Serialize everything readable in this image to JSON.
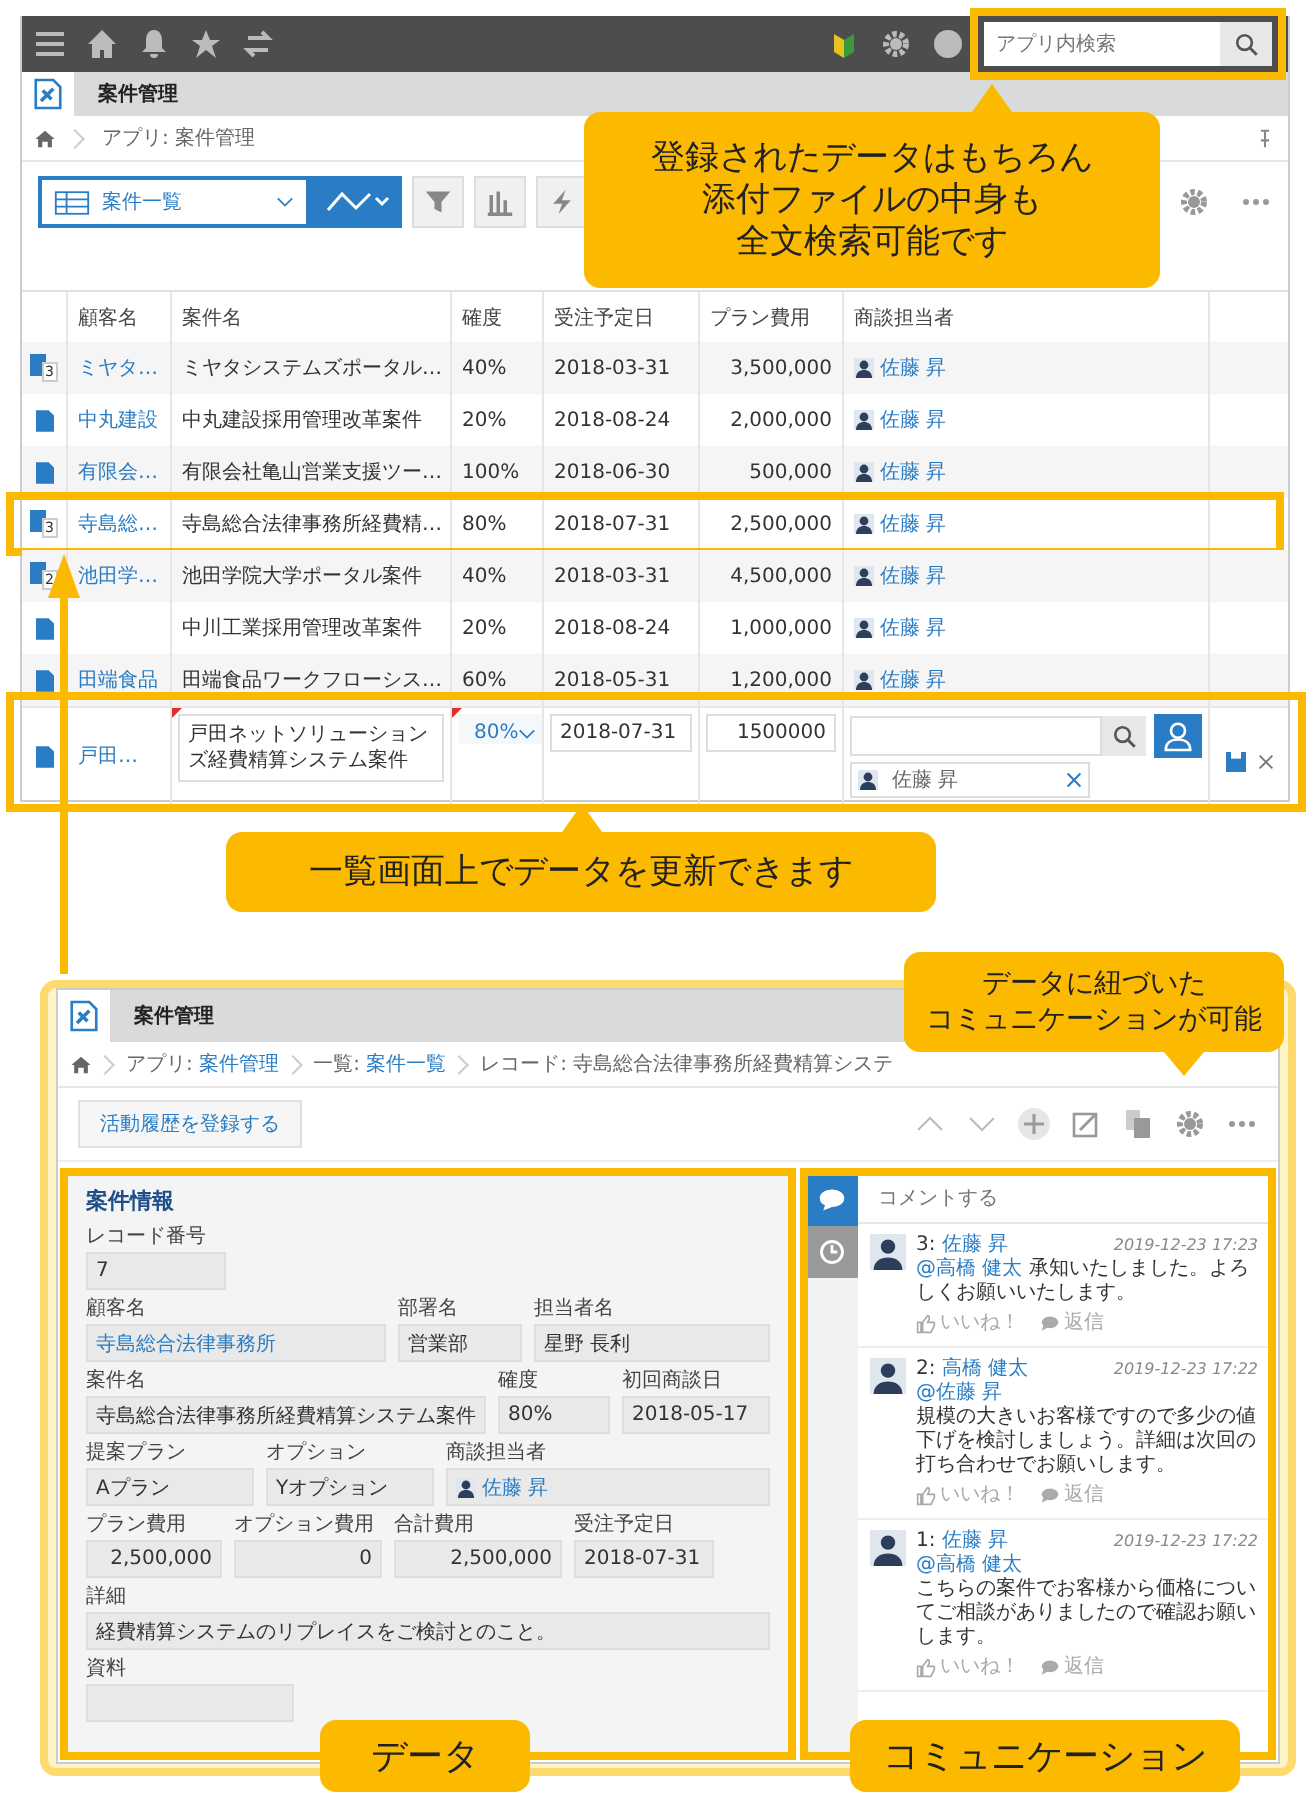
{
  "header": {
    "search": {
      "placeholder": "アプリ内検索"
    }
  },
  "app": {
    "title": "案件管理",
    "breadcrumb": "アプリ: 案件管理"
  },
  "view": {
    "name": "案件一覧"
  },
  "table": {
    "columns": [
      "顧客名",
      "案件名",
      "確度",
      "受注予定日",
      "プラン費用",
      "商談担当者"
    ],
    "rows": [
      {
        "badge": "3",
        "customer": "ミヤタ…",
        "deal": "ミヤタシステムズポータル…",
        "probability": "40%",
        "date": "2018-03-31",
        "cost": "3,500,000",
        "rep": "佐藤 昇",
        "highlighted": false
      },
      {
        "customer": "中丸建設",
        "deal": "中丸建設採用管理改革案件",
        "probability": "20%",
        "date": "2018-08-24",
        "cost": "2,000,000",
        "rep": "佐藤 昇",
        "highlighted": false
      },
      {
        "customer": "有限会…",
        "deal": "有限会社亀山営業支援ツー…",
        "probability": "100%",
        "date": "2018-06-30",
        "cost": "500,000",
        "rep": "佐藤 昇",
        "highlighted": false
      },
      {
        "badge": "3",
        "customer": "寺島総…",
        "deal": "寺島総合法律事務所経費精…",
        "probability": "80%",
        "date": "2018-07-31",
        "cost": "2,500,000",
        "rep": "佐藤 昇",
        "highlighted": true
      },
      {
        "badge": "2",
        "customer": "池田学…",
        "deal": "池田学院大学ポータル案件",
        "probability": "40%",
        "date": "2018-03-31",
        "cost": "4,500,000",
        "rep": "佐藤 昇",
        "highlighted": false
      },
      {
        "deal": "中川工業採用管理改革案件",
        "probability": "20%",
        "date": "2018-08-24",
        "cost": "1,000,000",
        "rep": "佐藤 昇",
        "highlighted": false
      },
      {
        "customer": "田端食品",
        "deal": "田端食品ワークフローシス…",
        "probability": "60%",
        "date": "2018-05-31",
        "cost": "1,200,000",
        "rep": "佐藤 昇",
        "highlighted": false
      }
    ],
    "edit_row": {
      "customer": "戸田…",
      "deal": "戸田ネットソリューションズ経費精算システム案件",
      "probability": "80%",
      "date": "2018-07-31",
      "cost": "1500000",
      "rep": "佐藤 昇"
    }
  },
  "callouts": [
    [
      "登録されたデータはもちろん",
      "添付ファイルの中身も",
      "全文検索可能です"
    ],
    [
      "一覧画面上でデータを更新できます"
    ],
    [
      "データに紐づいた",
      "コミュニケーションが可能"
    ]
  ],
  "labels": [
    "データ",
    "コミュニケーション"
  ],
  "detail": {
    "title": "案件管理",
    "breadcrumb": [
      {
        "prefix": "アプリ: ",
        "link": "案件管理"
      },
      {
        "prefix": "一覧: ",
        "link": "案件一覧"
      },
      {
        "prefix": "レコード: 寺島総合法律事務所経費精算システ"
      }
    ],
    "action_button": "活動履歴を登録する",
    "section": "案件情報",
    "field_rows": [
      [
        {
          "label": "レコード番号",
          "value": "7",
          "kind": "text"
        }
      ],
      [
        {
          "label": "顧客名",
          "value": "寺島総合法律事務所",
          "kind": "link"
        },
        {
          "label": "部署名",
          "value": "営業部",
          "kind": "text"
        },
        {
          "label": "担当者名",
          "value": "星野 長利",
          "kind": "text"
        }
      ],
      [
        {
          "label": "案件名",
          "value": "寺島総合法律事務所経費精算システム案件",
          "kind": "text"
        },
        {
          "label": "確度",
          "value": "80%",
          "kind": "text"
        },
        {
          "label": "初回商談日",
          "value": "2018-05-17",
          "kind": "text"
        }
      ],
      [
        {
          "label": "提案プラン",
          "value": "Aプラン",
          "kind": "text"
        },
        {
          "label": "オプション",
          "value": "Yオプション",
          "kind": "text"
        },
        {
          "label": "商談担当者",
          "value": "佐藤 昇",
          "kind": "user"
        }
      ],
      [
        {
          "label": "プラン費用",
          "value": "2,500,000",
          "kind": "number"
        },
        {
          "label": "オプション費用",
          "value": "0",
          "kind": "number"
        },
        {
          "label": "合計費用",
          "value": "2,500,000",
          "kind": "number"
        },
        {
          "label": "受注予定日",
          "value": "2018-07-31",
          "kind": "text"
        }
      ],
      [
        {
          "label": "詳細",
          "value": "経費精算システムのリプレイスをご検討とのこと。",
          "kind": "text"
        }
      ],
      [
        {
          "label": "資料",
          "kind": "file"
        }
      ]
    ],
    "side_tabs": [
      {
        "kind": "comments",
        "selected": true
      },
      {
        "kind": "history",
        "selected": false
      }
    ],
    "comment_field": {
      "placeholder": "コメントする"
    },
    "comments": [
      {
        "number": "3:",
        "author": "佐藤 昇",
        "time": "2019-12-23 17:23",
        "mention": "@高橋 健太",
        "mention_inline": true,
        "text": "承知いたしました。よろしくお願いいたします。",
        "like": "いいね！",
        "reply": "返信"
      },
      {
        "number": "2:",
        "author": "高橋 健太",
        "time": "2019-12-23 17:22",
        "mention": "@佐藤 昇",
        "mention_inline": false,
        "text": "規模の大きいお客様ですので多少の値下げを検討しましょう。詳細は次回の打ち合わせでお願いします。",
        "like": "いいね！",
        "reply": "返信"
      },
      {
        "number": "1:",
        "author": "佐藤 昇",
        "time": "2019-12-23 17:22",
        "mention": "@高橋 健太",
        "mention_inline": false,
        "text": "こちらの案件でお客様から価格についてご相談がありましたので確認お願いします。",
        "like": "いいね！",
        "reply": "返信"
      }
    ]
  }
}
